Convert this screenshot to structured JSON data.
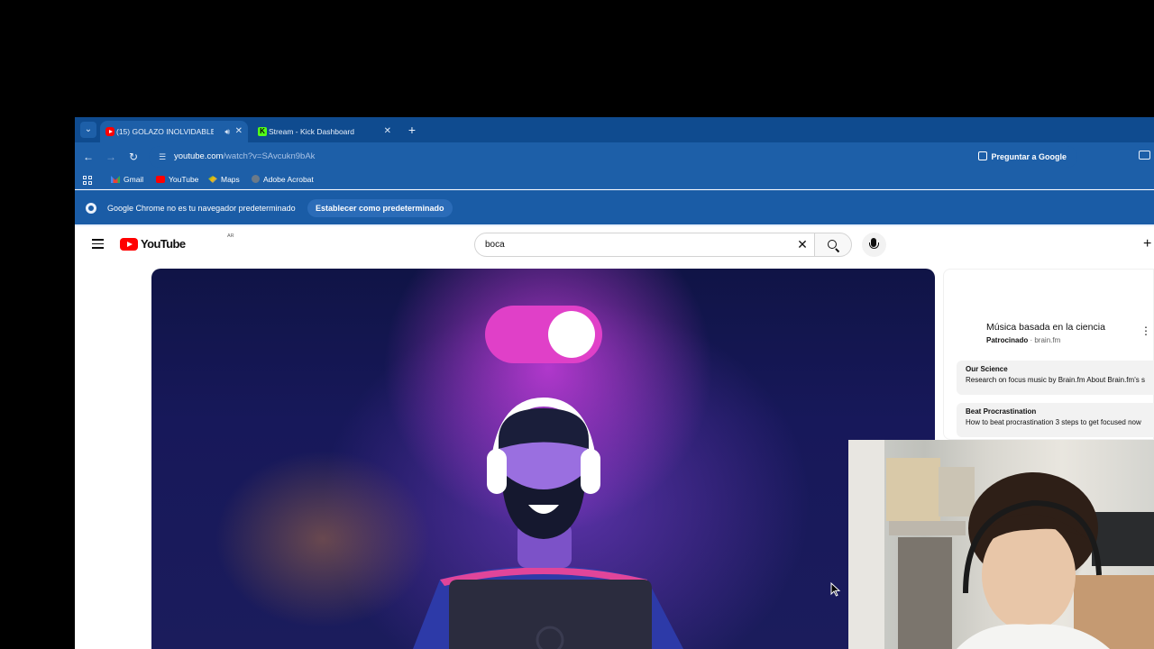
{
  "tabs": [
    {
      "title": "(15) GOLAZO INOLVIDABLE",
      "active": true,
      "icon": "youtube-icon",
      "audio": true
    },
    {
      "title": "Stream - Kick Dashboard",
      "active": false,
      "icon": "kick-icon",
      "audio": false
    }
  ],
  "address": {
    "host": "youtube.com",
    "rest": "/watch?v=SAvcukn9bAk"
  },
  "ask_google": "Preguntar a Google",
  "bookmarks": [
    "Gmail",
    "YouTube",
    "Maps",
    "Adobe Acrobat"
  ],
  "infobar": {
    "text": "Google Chrome no es tu navegador predeterminado",
    "button": "Establecer como predeterminado"
  },
  "youtube": {
    "logo_text": "YouTube",
    "country": "AR",
    "search_query": "boca"
  },
  "ad": {
    "title": "Música basada en la ciencia",
    "sponsored": "Patrocinado",
    "domain": "· brain.fm",
    "links": [
      {
        "heading": "Our Science",
        "description": "Research on focus music by Brain.fm About Brain.fm's s"
      },
      {
        "heading": "Beat Procrastination",
        "description": "How to beat procrastination 3 steps to get focused now"
      }
    ]
  },
  "colors": {
    "chrome_tabstrip": "#0f4b8f",
    "chrome_toolbar": "#1d5fa8",
    "youtube_red": "#ff0000",
    "toggle_magenta": "#e040c8"
  }
}
